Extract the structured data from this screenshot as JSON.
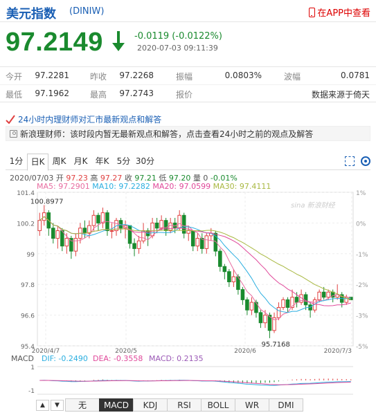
{
  "header": {
    "title": "美元指数",
    "code": "(DINIW)",
    "app_link": "在APP中查看"
  },
  "quote": {
    "price": "97.2149",
    "change": "-0.0119 (-0.0122%)",
    "timestamp": "2020-07-03 09:11:39"
  },
  "stats": [
    {
      "l1": "今开",
      "v1": "97.2281",
      "l2": "昨收",
      "v2": "97.2268",
      "l3": "振幅",
      "v3": "0.0803%",
      "l4": "波幅",
      "v4": "0.0781"
    },
    {
      "l1": "最低",
      "v1": "97.1962",
      "l2": "最高",
      "v2": "97.2743",
      "l3": "报价",
      "v3": "",
      "l4": "",
      "v4": "数据来源于倚天"
    }
  ],
  "news": {
    "headline": "24小时内理财师对汇市最新观点和解答",
    "text": "新浪理财师：该时段内暂无最新观点和解答，点击查看24小时之前的观点及解答"
  },
  "tabs": [
    "1分",
    "日K",
    "周K",
    "月K",
    "年K",
    "5分",
    "30分"
  ],
  "ohlc": {
    "date": "2020/07/03",
    "open_label": "开",
    "open": "97.23",
    "high_label": "高",
    "high": "97.27",
    "close_label": "收",
    "close": "97.21",
    "low_label": "低",
    "low": "97.20",
    "vol_label": "量",
    "vol": "0",
    "pct": "-0.01%"
  },
  "ma": [
    {
      "text": "MA5: 97.2901",
      "color": "#e86ca0"
    },
    {
      "text": "MA10: 97.2282",
      "color": "#2aaee0"
    },
    {
      "text": "MA20: 97.0599",
      "color": "#e0489a"
    },
    {
      "text": "MA30: 97.4111",
      "color": "#a8b840"
    }
  ],
  "watermark": "sina 新浪财经",
  "macd": {
    "label": "MACD",
    "dif": "DIF: -0.2490",
    "dea": "DEA: -0.3558",
    "macd": "MACD: 0.2135"
  },
  "buttons": [
    "无",
    "MACD",
    "KDJ",
    "RSI",
    "BOLL",
    "WR",
    "DMI"
  ],
  "colors": {
    "up": "#e04040",
    "down": "#1a8a2e",
    "brand": "#1a5fb4"
  },
  "chart_data": {
    "type": "candlestick",
    "y_ticks": [
      "101.4",
      "100.2",
      "99",
      "97.8",
      "96.6",
      "95.4"
    ],
    "y_pct_ticks": [
      "1%",
      "0%",
      "-1%",
      "-2%",
      "-3%",
      "-5%"
    ],
    "x_ticks": [
      "2020/4/7",
      "2020/5",
      "2020/6",
      "2020/7/3"
    ],
    "annotations": [
      "100.8977",
      "95.7168"
    ],
    "ylim": [
      95.4,
      101.4
    ],
    "macd_ticks": [
      "1",
      "-1"
    ],
    "candles": [
      {
        "o": 99.9,
        "c": 100.3,
        "h": 100.6,
        "l": 99.7
      },
      {
        "o": 100.3,
        "c": 100.6,
        "h": 100.9,
        "l": 100.1
      },
      {
        "o": 100.6,
        "c": 100.0,
        "h": 100.7,
        "l": 99.7
      },
      {
        "o": 100.0,
        "c": 99.6,
        "h": 100.2,
        "l": 99.4
      },
      {
        "o": 99.6,
        "c": 99.9,
        "h": 100.1,
        "l": 99.2
      },
      {
        "o": 99.9,
        "c": 99.3,
        "h": 100.0,
        "l": 99.1
      },
      {
        "o": 99.3,
        "c": 99.6,
        "h": 99.8,
        "l": 99.0
      },
      {
        "o": 99.6,
        "c": 99.1,
        "h": 99.7,
        "l": 98.8
      },
      {
        "o": 99.1,
        "c": 99.6,
        "h": 99.8,
        "l": 98.9
      },
      {
        "o": 99.6,
        "c": 100.0,
        "h": 100.2,
        "l": 99.4
      },
      {
        "o": 100.0,
        "c": 99.8,
        "h": 100.3,
        "l": 99.6
      },
      {
        "o": 99.8,
        "c": 100.1,
        "h": 100.3,
        "l": 99.6
      },
      {
        "o": 100.1,
        "c": 100.5,
        "h": 100.7,
        "l": 99.9
      },
      {
        "o": 100.5,
        "c": 100.2,
        "h": 100.6,
        "l": 99.9
      },
      {
        "o": 100.2,
        "c": 100.6,
        "h": 100.8,
        "l": 100.0
      },
      {
        "o": 100.6,
        "c": 99.9,
        "h": 100.7,
        "l": 99.7
      },
      {
        "o": 99.9,
        "c": 99.9,
        "h": 100.2,
        "l": 99.6
      },
      {
        "o": 99.9,
        "c": 100.3,
        "h": 100.4,
        "l": 99.7
      },
      {
        "o": 100.3,
        "c": 100.0,
        "h": 100.4,
        "l": 99.8
      },
      {
        "o": 100.0,
        "c": 100.1,
        "h": 100.3,
        "l": 99.6
      },
      {
        "o": 100.1,
        "c": 99.4,
        "h": 100.1,
        "l": 99.2
      },
      {
        "o": 99.4,
        "c": 99.2,
        "h": 99.6,
        "l": 98.9
      },
      {
        "o": 99.2,
        "c": 99.5,
        "h": 99.7,
        "l": 99.0
      },
      {
        "o": 99.5,
        "c": 99.9,
        "h": 100.2,
        "l": 99.4
      },
      {
        "o": 99.9,
        "c": 99.7,
        "h": 100.0,
        "l": 99.3
      },
      {
        "o": 99.7,
        "c": 100.2,
        "h": 100.4,
        "l": 99.6
      },
      {
        "o": 100.2,
        "c": 100.0,
        "h": 100.4,
        "l": 99.8
      },
      {
        "o": 100.0,
        "c": 100.3,
        "h": 100.5,
        "l": 99.9
      },
      {
        "o": 100.3,
        "c": 99.9,
        "h": 100.4,
        "l": 99.7
      },
      {
        "o": 99.9,
        "c": 100.2,
        "h": 100.4,
        "l": 99.8
      },
      {
        "o": 100.2,
        "c": 100.0,
        "h": 100.4,
        "l": 99.8
      },
      {
        "o": 100.0,
        "c": 100.5,
        "h": 100.7,
        "l": 99.9
      },
      {
        "o": 100.5,
        "c": 99.8,
        "h": 100.6,
        "l": 99.6
      },
      {
        "o": 99.8,
        "c": 99.9,
        "h": 100.1,
        "l": 99.5
      },
      {
        "o": 99.9,
        "c": 99.3,
        "h": 99.9,
        "l": 99.1
      },
      {
        "o": 99.3,
        "c": 99.6,
        "h": 99.8,
        "l": 99.1
      },
      {
        "o": 99.6,
        "c": 99.2,
        "h": 99.8,
        "l": 99.0
      },
      {
        "o": 99.2,
        "c": 99.7,
        "h": 99.8,
        "l": 99.0
      },
      {
        "o": 99.7,
        "c": 99.8,
        "h": 100.0,
        "l": 99.5
      },
      {
        "o": 99.8,
        "c": 99.1,
        "h": 99.9,
        "l": 98.9
      },
      {
        "o": 99.1,
        "c": 98.5,
        "h": 99.2,
        "l": 98.3
      },
      {
        "o": 98.5,
        "c": 98.3,
        "h": 98.6,
        "l": 98.0
      },
      {
        "o": 98.3,
        "c": 97.9,
        "h": 98.4,
        "l": 97.7
      },
      {
        "o": 97.9,
        "c": 98.1,
        "h": 98.4,
        "l": 97.7
      },
      {
        "o": 98.1,
        "c": 97.6,
        "h": 98.2,
        "l": 97.4
      },
      {
        "o": 97.6,
        "c": 97.2,
        "h": 97.7,
        "l": 97.0
      },
      {
        "o": 97.2,
        "c": 96.8,
        "h": 97.3,
        "l": 96.6
      },
      {
        "o": 96.8,
        "c": 97.1,
        "h": 97.3,
        "l": 96.6
      },
      {
        "o": 97.1,
        "c": 96.7,
        "h": 97.2,
        "l": 96.5
      },
      {
        "o": 96.7,
        "c": 96.3,
        "h": 96.8,
        "l": 96.1
      },
      {
        "o": 96.3,
        "c": 96.6,
        "h": 96.8,
        "l": 96.1
      },
      {
        "o": 96.6,
        "c": 96.0,
        "h": 96.7,
        "l": 95.7
      },
      {
        "o": 96.0,
        "c": 96.5,
        "h": 96.7,
        "l": 95.9
      },
      {
        "o": 96.5,
        "c": 96.9,
        "h": 97.1,
        "l": 96.4
      },
      {
        "o": 96.9,
        "c": 97.2,
        "h": 97.3,
        "l": 96.8
      },
      {
        "o": 97.2,
        "c": 96.9,
        "h": 97.3,
        "l": 96.7
      },
      {
        "o": 96.9,
        "c": 97.3,
        "h": 97.6,
        "l": 96.8
      },
      {
        "o": 97.3,
        "c": 97.1,
        "h": 97.5,
        "l": 96.9
      },
      {
        "o": 97.1,
        "c": 97.4,
        "h": 97.6,
        "l": 97.0
      },
      {
        "o": 97.4,
        "c": 97.0,
        "h": 97.5,
        "l": 96.8
      },
      {
        "o": 97.0,
        "c": 96.8,
        "h": 97.1,
        "l": 96.5
      },
      {
        "o": 96.8,
        "c": 97.2,
        "h": 97.3,
        "l": 96.7
      },
      {
        "o": 97.2,
        "c": 97.5,
        "h": 97.6,
        "l": 97.1
      },
      {
        "o": 97.5,
        "c": 97.3,
        "h": 97.7,
        "l": 97.2
      },
      {
        "o": 97.3,
        "c": 97.5,
        "h": 97.6,
        "l": 97.2
      },
      {
        "o": 97.5,
        "c": 97.3,
        "h": 97.6,
        "l": 97.1
      },
      {
        "o": 97.3,
        "c": 97.4,
        "h": 97.8,
        "l": 97.2
      },
      {
        "o": 97.4,
        "c": 97.1,
        "h": 97.5,
        "l": 96.9
      },
      {
        "o": 97.1,
        "c": 97.3,
        "h": 97.4,
        "l": 97.0
      },
      {
        "o": 97.3,
        "c": 97.2,
        "h": 97.3,
        "l": 97.2
      }
    ]
  }
}
